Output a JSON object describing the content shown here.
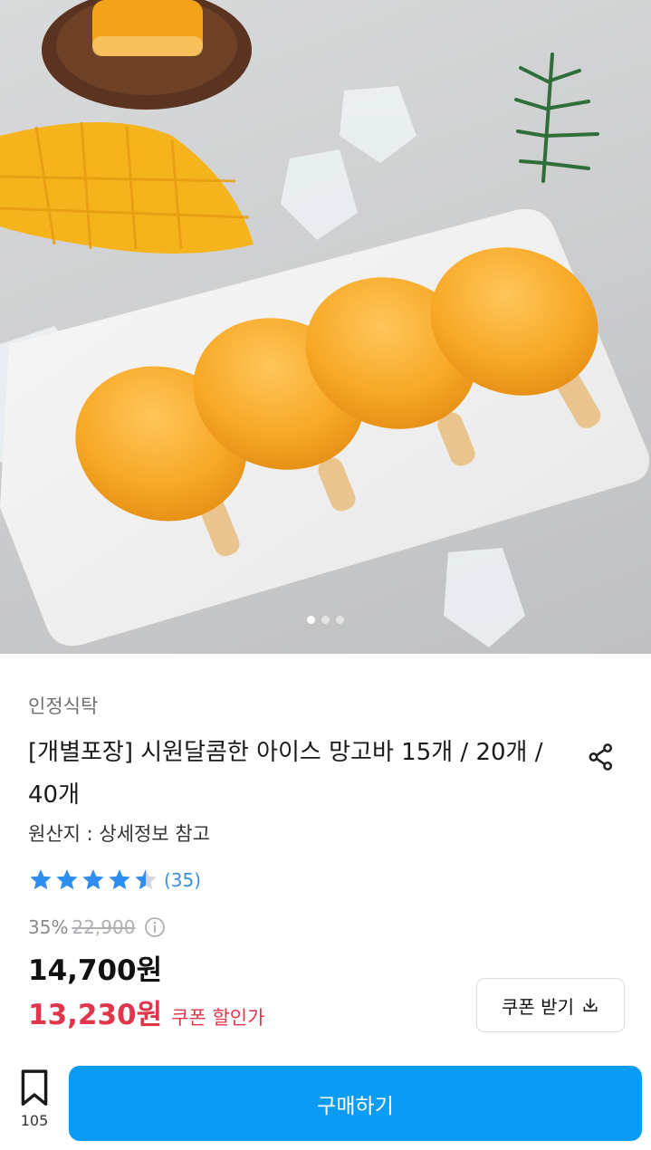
{
  "colors": {
    "accent": "#0a9cf5",
    "coupon_red": "#e0364c",
    "star": "#2f8ff0",
    "review_link": "#3b8fe0"
  },
  "gallery": {
    "image_icon": "mango-ice-bar-product-photo",
    "page_count": 3,
    "active_page": 1
  },
  "product": {
    "seller": "인정식탁",
    "title": "[개별포장] 시원달콤한 아이스 망고바 15개 / 20개 / 40개",
    "origin": "원산지 : 상세정보 참고",
    "share_icon": "share-icon"
  },
  "rating": {
    "score": 4.5,
    "max": 5,
    "review_count": "(35)"
  },
  "pricing": {
    "discount_rate": "35%",
    "original_price": "22,900",
    "price": "14,700원",
    "coupon_price": "13,230원",
    "coupon_label": "쿠폰 할인가",
    "coupon_button": "쿠폰 받기"
  },
  "bottom_bar": {
    "bookmark_count": "105",
    "buy_label": "구매하기"
  }
}
